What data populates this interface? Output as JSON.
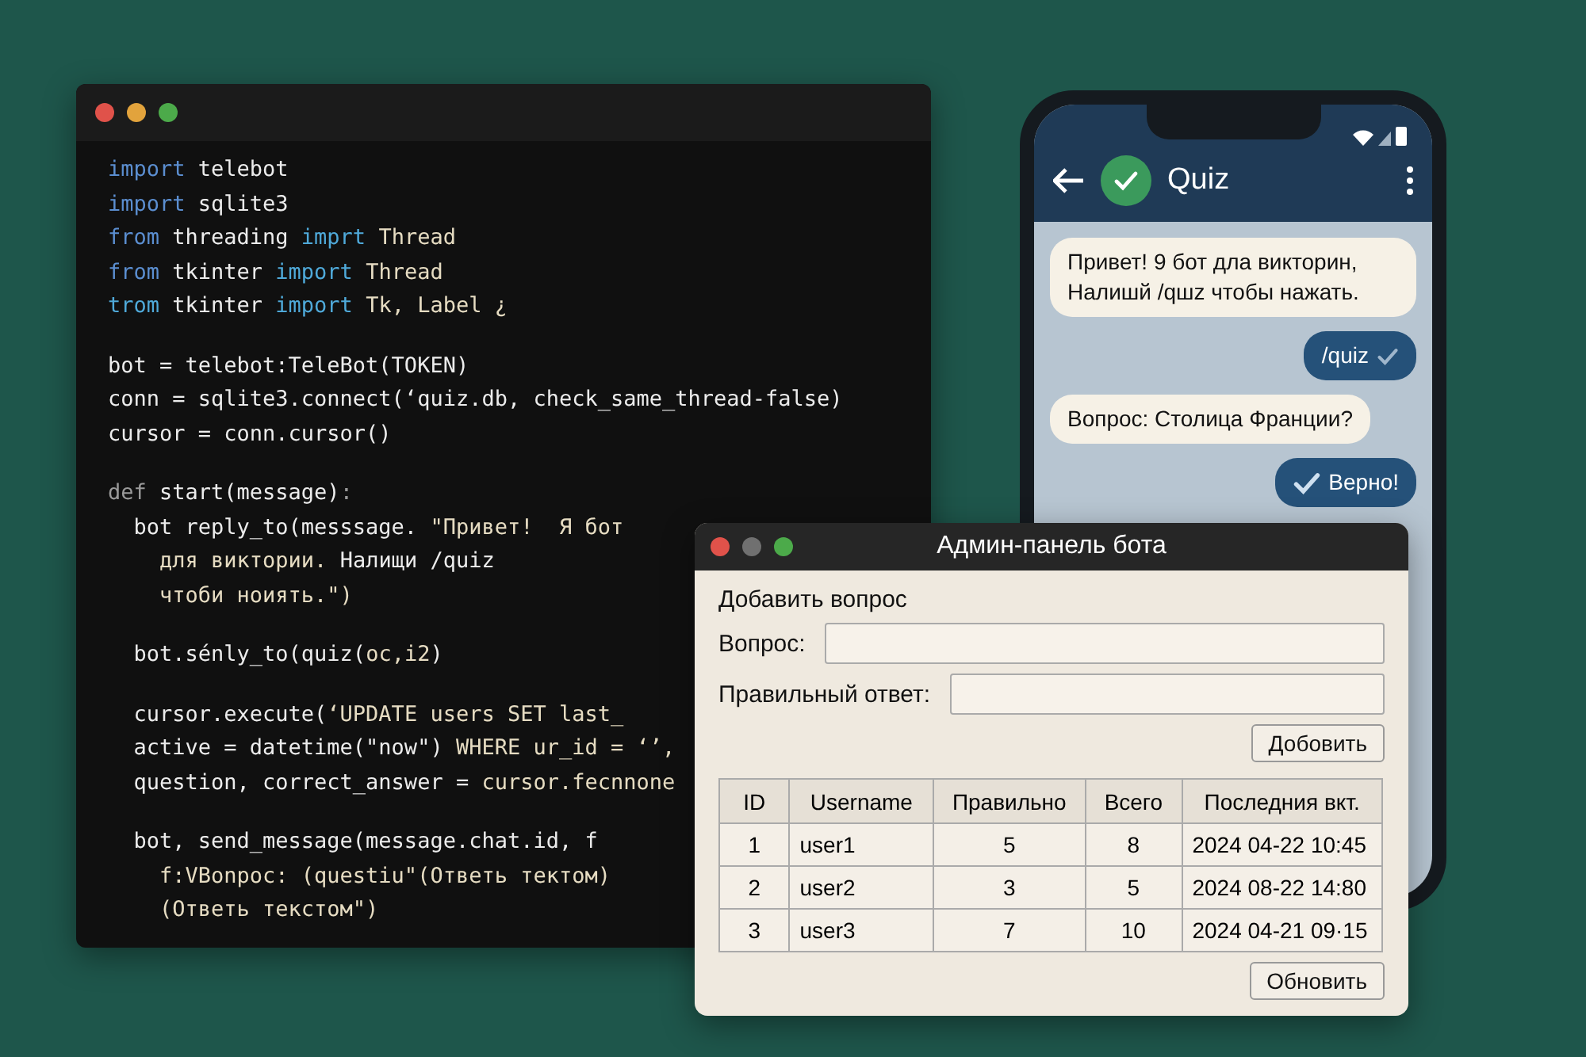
{
  "code_window": {
    "blocks": [
      [
        {
          "tokens": [
            {
              "text": "import",
              "kind": "keyword"
            },
            {
              "text": " telebot",
              "kind": "plain"
            }
          ]
        },
        {
          "tokens": [
            {
              "text": "import",
              "kind": "keyword"
            },
            {
              "text": " sqlite3",
              "kind": "plain"
            }
          ]
        },
        {
          "tokens": [
            {
              "text": "from",
              "kind": "keyword"
            },
            {
              "text": " threading ",
              "kind": "plain"
            },
            {
              "text": "imprt",
              "kind": "accent"
            },
            {
              "text": " Thread",
              "kind": "string"
            }
          ]
        },
        {
          "tokens": [
            {
              "text": "from",
              "kind": "keyword"
            },
            {
              "text": " tkinter ",
              "kind": "plain"
            },
            {
              "text": "import",
              "kind": "accent"
            },
            {
              "text": " Thread",
              "kind": "string"
            }
          ]
        },
        {
          "tokens": [
            {
              "text": "trom",
              "kind": "accent"
            },
            {
              "text": " tkinter ",
              "kind": "plain"
            },
            {
              "text": "import",
              "kind": "accent"
            },
            {
              "text": " Tk, Label ¿",
              "kind": "string"
            }
          ]
        }
      ],
      [
        {
          "tokens": [
            {
              "text": "bot = telebot:TeleBot(TOKEN)",
              "kind": "plain"
            }
          ]
        },
        {
          "tokens": [
            {
              "text": "conn = sqlite3.connect(‘quiz.db, check_same_thread-false)",
              "kind": "plain"
            }
          ]
        },
        {
          "tokens": [
            {
              "text": "cursor = conn.cursor()",
              "kind": "plain"
            }
          ]
        }
      ],
      [
        {
          "tokens": [
            {
              "text": "def",
              "kind": "muted"
            },
            {
              "text": " start(message)",
              "kind": "plain"
            },
            {
              "text": ":",
              "kind": "muted"
            }
          ]
        },
        {
          "tokens": [
            {
              "text": "  bot reply_to(messsage. ",
              "kind": "plain"
            },
            {
              "text": "\"Привет!  Я бот",
              "kind": "string"
            }
          ]
        },
        {
          "tokens": [
            {
              "text": "    для виктории. ",
              "kind": "string"
            },
            {
              "text": "Налищи /quiz",
              "kind": "plain"
            }
          ]
        },
        {
          "tokens": [
            {
              "text": "    чтоби ноиять.\")",
              "kind": "string"
            }
          ]
        }
      ],
      [
        {
          "tokens": [
            {
              "text": "  bot.sénly_to(quiz(",
              "kind": "plain"
            },
            {
              "text": "oc,i2",
              "kind": "string"
            },
            {
              "text": ")",
              "kind": "plain"
            }
          ]
        }
      ],
      [
        {
          "tokens": [
            {
              "text": "  cursor.execute(",
              "kind": "plain"
            },
            {
              "text": "‘UPDATE users SET last_",
              "kind": "string"
            }
          ]
        },
        {
          "tokens": [
            {
              "text": "  active = datetime(\"now\") ",
              "kind": "plain"
            },
            {
              "text": "WHERE ur_id = ‘’,",
              "kind": "string"
            }
          ]
        },
        {
          "tokens": [
            {
              "text": "  question, correct_answer = ",
              "kind": "plain"
            },
            {
              "text": "cursor.fecnnone",
              "kind": "string"
            }
          ]
        }
      ],
      [
        {
          "tokens": [
            {
              "text": "  bot, send_message(message.chat.id, f",
              "kind": "plain"
            }
          ]
        },
        {
          "tokens": [
            {
              "text": "    f:VBonpoc: (questiu\"(Ответь тектом)",
              "kind": "string"
            }
          ]
        },
        {
          "tokens": [
            {
              "text": "    (Ответь текстом\")",
              "kind": "string"
            }
          ]
        }
      ]
    ]
  },
  "phone": {
    "chat_title": "Quiz",
    "messages": [
      {
        "text": "Привет! 9 бот дла викторин, Налишй /qшz чтобы нaжать.",
        "kind": "incoming"
      },
      {
        "text": "/quiz",
        "kind": "command"
      },
      {
        "text": "Вопрос: Столица Франции?",
        "kind": "incoming"
      },
      {
        "text": "Верно!",
        "kind": "answer"
      }
    ]
  },
  "admin_window": {
    "title": "Админ-панель бота",
    "section_title": "Добавить вопрос",
    "fields": [
      {
        "label": "Вопрос:"
      },
      {
        "label": "Правильный ответ:"
      }
    ],
    "add_button": "Добовить",
    "table": {
      "columns": [
        "ID",
        "Username",
        "Правильно",
        "Всего",
        "Последния вкт."
      ],
      "rows": [
        [
          "1",
          "user1",
          "5",
          "8",
          "2024 04-22 10:45"
        ],
        [
          "2",
          "user2",
          "3",
          "5",
          "2024 08-22 14:80"
        ],
        [
          "3",
          "user3",
          "7",
          "10",
          "2024 04-21 09·15"
        ]
      ]
    },
    "refresh_button": "Обновить"
  }
}
